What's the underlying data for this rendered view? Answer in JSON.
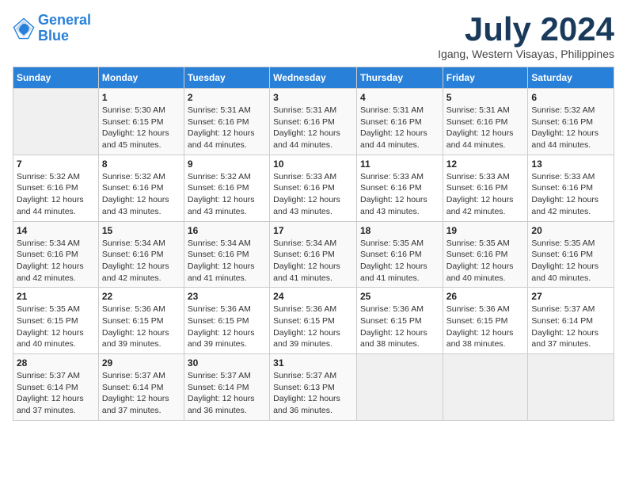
{
  "header": {
    "logo_line1": "General",
    "logo_line2": "Blue",
    "title": "July 2024",
    "subtitle": "Igang, Western Visayas, Philippines"
  },
  "weekdays": [
    "Sunday",
    "Monday",
    "Tuesday",
    "Wednesday",
    "Thursday",
    "Friday",
    "Saturday"
  ],
  "weeks": [
    [
      {
        "num": "",
        "sunrise": "",
        "sunset": "",
        "daylight": ""
      },
      {
        "num": "1",
        "sunrise": "Sunrise: 5:30 AM",
        "sunset": "Sunset: 6:15 PM",
        "daylight": "Daylight: 12 hours and 45 minutes."
      },
      {
        "num": "2",
        "sunrise": "Sunrise: 5:31 AM",
        "sunset": "Sunset: 6:16 PM",
        "daylight": "Daylight: 12 hours and 44 minutes."
      },
      {
        "num": "3",
        "sunrise": "Sunrise: 5:31 AM",
        "sunset": "Sunset: 6:16 PM",
        "daylight": "Daylight: 12 hours and 44 minutes."
      },
      {
        "num": "4",
        "sunrise": "Sunrise: 5:31 AM",
        "sunset": "Sunset: 6:16 PM",
        "daylight": "Daylight: 12 hours and 44 minutes."
      },
      {
        "num": "5",
        "sunrise": "Sunrise: 5:31 AM",
        "sunset": "Sunset: 6:16 PM",
        "daylight": "Daylight: 12 hours and 44 minutes."
      },
      {
        "num": "6",
        "sunrise": "Sunrise: 5:32 AM",
        "sunset": "Sunset: 6:16 PM",
        "daylight": "Daylight: 12 hours and 44 minutes."
      }
    ],
    [
      {
        "num": "7",
        "sunrise": "Sunrise: 5:32 AM",
        "sunset": "Sunset: 6:16 PM",
        "daylight": "Daylight: 12 hours and 44 minutes."
      },
      {
        "num": "8",
        "sunrise": "Sunrise: 5:32 AM",
        "sunset": "Sunset: 6:16 PM",
        "daylight": "Daylight: 12 hours and 43 minutes."
      },
      {
        "num": "9",
        "sunrise": "Sunrise: 5:32 AM",
        "sunset": "Sunset: 6:16 PM",
        "daylight": "Daylight: 12 hours and 43 minutes."
      },
      {
        "num": "10",
        "sunrise": "Sunrise: 5:33 AM",
        "sunset": "Sunset: 6:16 PM",
        "daylight": "Daylight: 12 hours and 43 minutes."
      },
      {
        "num": "11",
        "sunrise": "Sunrise: 5:33 AM",
        "sunset": "Sunset: 6:16 PM",
        "daylight": "Daylight: 12 hours and 43 minutes."
      },
      {
        "num": "12",
        "sunrise": "Sunrise: 5:33 AM",
        "sunset": "Sunset: 6:16 PM",
        "daylight": "Daylight: 12 hours and 42 minutes."
      },
      {
        "num": "13",
        "sunrise": "Sunrise: 5:33 AM",
        "sunset": "Sunset: 6:16 PM",
        "daylight": "Daylight: 12 hours and 42 minutes."
      }
    ],
    [
      {
        "num": "14",
        "sunrise": "Sunrise: 5:34 AM",
        "sunset": "Sunset: 6:16 PM",
        "daylight": "Daylight: 12 hours and 42 minutes."
      },
      {
        "num": "15",
        "sunrise": "Sunrise: 5:34 AM",
        "sunset": "Sunset: 6:16 PM",
        "daylight": "Daylight: 12 hours and 42 minutes."
      },
      {
        "num": "16",
        "sunrise": "Sunrise: 5:34 AM",
        "sunset": "Sunset: 6:16 PM",
        "daylight": "Daylight: 12 hours and 41 minutes."
      },
      {
        "num": "17",
        "sunrise": "Sunrise: 5:34 AM",
        "sunset": "Sunset: 6:16 PM",
        "daylight": "Daylight: 12 hours and 41 minutes."
      },
      {
        "num": "18",
        "sunrise": "Sunrise: 5:35 AM",
        "sunset": "Sunset: 6:16 PM",
        "daylight": "Daylight: 12 hours and 41 minutes."
      },
      {
        "num": "19",
        "sunrise": "Sunrise: 5:35 AM",
        "sunset": "Sunset: 6:16 PM",
        "daylight": "Daylight: 12 hours and 40 minutes."
      },
      {
        "num": "20",
        "sunrise": "Sunrise: 5:35 AM",
        "sunset": "Sunset: 6:16 PM",
        "daylight": "Daylight: 12 hours and 40 minutes."
      }
    ],
    [
      {
        "num": "21",
        "sunrise": "Sunrise: 5:35 AM",
        "sunset": "Sunset: 6:15 PM",
        "daylight": "Daylight: 12 hours and 40 minutes."
      },
      {
        "num": "22",
        "sunrise": "Sunrise: 5:36 AM",
        "sunset": "Sunset: 6:15 PM",
        "daylight": "Daylight: 12 hours and 39 minutes."
      },
      {
        "num": "23",
        "sunrise": "Sunrise: 5:36 AM",
        "sunset": "Sunset: 6:15 PM",
        "daylight": "Daylight: 12 hours and 39 minutes."
      },
      {
        "num": "24",
        "sunrise": "Sunrise: 5:36 AM",
        "sunset": "Sunset: 6:15 PM",
        "daylight": "Daylight: 12 hours and 39 minutes."
      },
      {
        "num": "25",
        "sunrise": "Sunrise: 5:36 AM",
        "sunset": "Sunset: 6:15 PM",
        "daylight": "Daylight: 12 hours and 38 minutes."
      },
      {
        "num": "26",
        "sunrise": "Sunrise: 5:36 AM",
        "sunset": "Sunset: 6:15 PM",
        "daylight": "Daylight: 12 hours and 38 minutes."
      },
      {
        "num": "27",
        "sunrise": "Sunrise: 5:37 AM",
        "sunset": "Sunset: 6:14 PM",
        "daylight": "Daylight: 12 hours and 37 minutes."
      }
    ],
    [
      {
        "num": "28",
        "sunrise": "Sunrise: 5:37 AM",
        "sunset": "Sunset: 6:14 PM",
        "daylight": "Daylight: 12 hours and 37 minutes."
      },
      {
        "num": "29",
        "sunrise": "Sunrise: 5:37 AM",
        "sunset": "Sunset: 6:14 PM",
        "daylight": "Daylight: 12 hours and 37 minutes."
      },
      {
        "num": "30",
        "sunrise": "Sunrise: 5:37 AM",
        "sunset": "Sunset: 6:14 PM",
        "daylight": "Daylight: 12 hours and 36 minutes."
      },
      {
        "num": "31",
        "sunrise": "Sunrise: 5:37 AM",
        "sunset": "Sunset: 6:13 PM",
        "daylight": "Daylight: 12 hours and 36 minutes."
      },
      {
        "num": "",
        "sunrise": "",
        "sunset": "",
        "daylight": ""
      },
      {
        "num": "",
        "sunrise": "",
        "sunset": "",
        "daylight": ""
      },
      {
        "num": "",
        "sunrise": "",
        "sunset": "",
        "daylight": ""
      }
    ]
  ]
}
